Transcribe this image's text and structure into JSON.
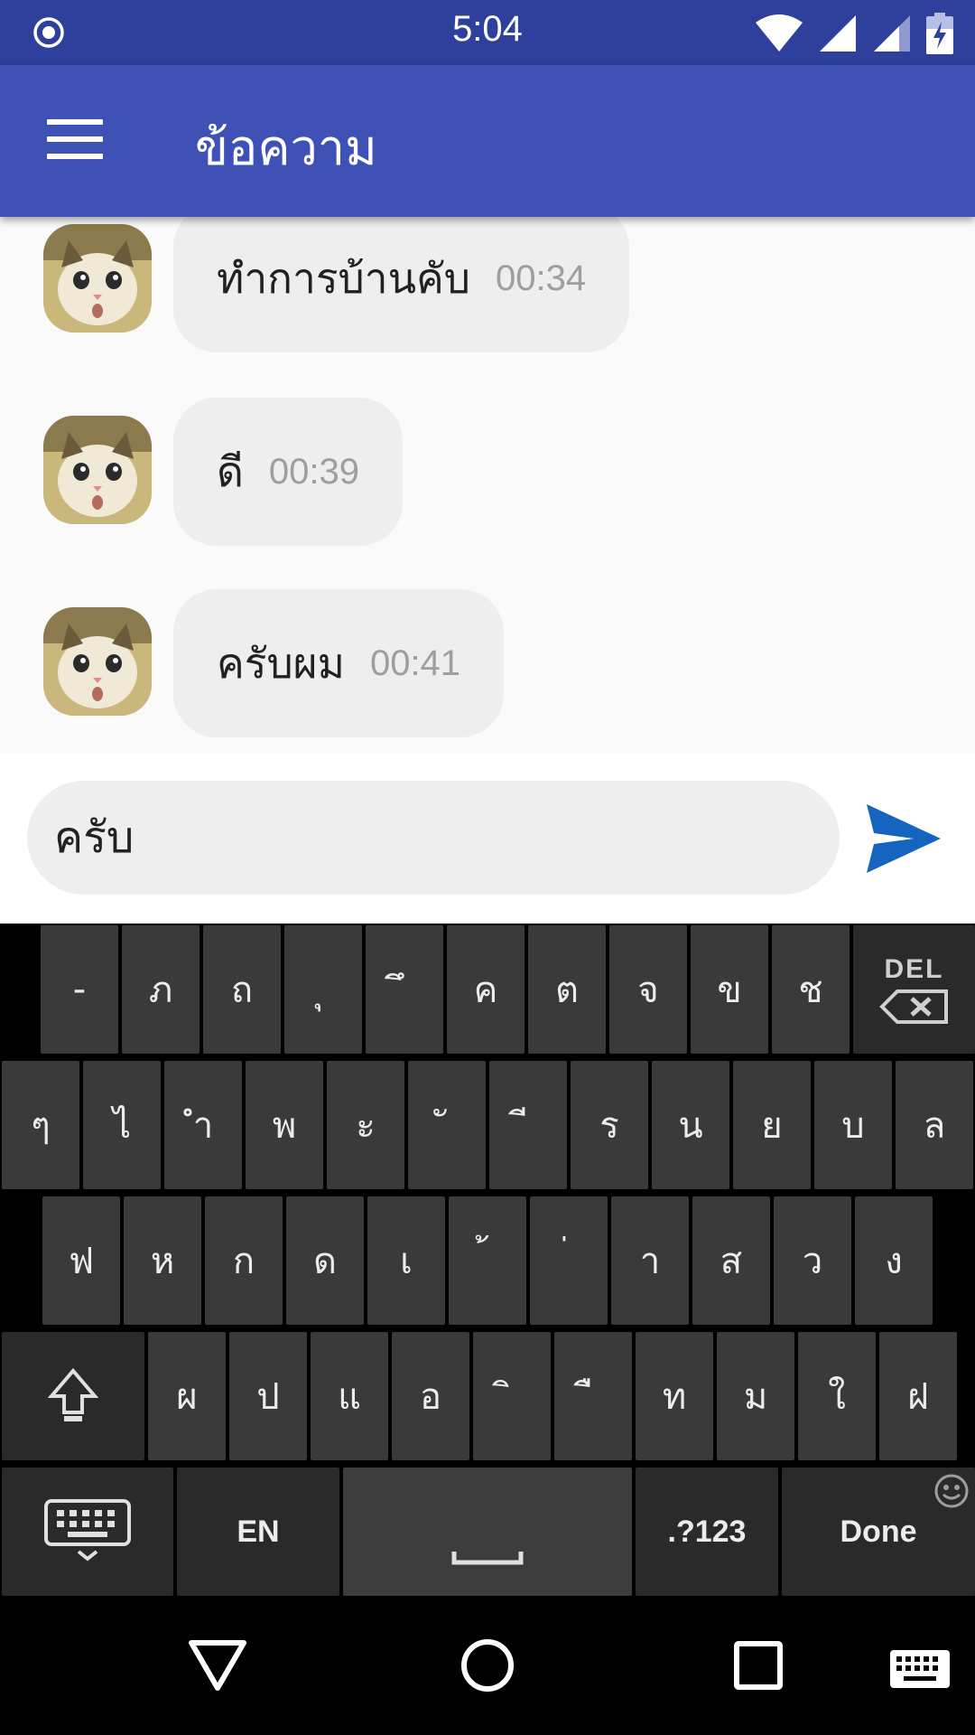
{
  "status_bar": {
    "time": "5:04",
    "left_icon": "record-icon",
    "right_icons": [
      "wifi-icon",
      "signal-icon",
      "signal-icon",
      "battery-charging-icon"
    ]
  },
  "app_bar": {
    "title": "ข้อความ",
    "menu_icon": "menu-icon"
  },
  "messages": [
    {
      "text": "ทำการบ้านคับ",
      "time": "00:34"
    },
    {
      "text": "ดี",
      "time": "00:39"
    },
    {
      "text": "ครับผม",
      "time": "00:41"
    }
  ],
  "composer": {
    "value": "ครับ",
    "send_icon": "send-icon"
  },
  "keyboard": {
    "row1": [
      "-",
      "ภ",
      "ถ",
      "ุ",
      "ึ",
      "ค",
      "ต",
      "จ",
      "ข",
      "ช"
    ],
    "del_label": "DEL",
    "row2": [
      "ๆ",
      "ไ",
      "ำ",
      "พ",
      "ะ",
      "ั",
      "ี",
      "ร",
      "น",
      "ย",
      "บ",
      "ล"
    ],
    "row3": [
      "ฟ",
      "ห",
      "ก",
      "ด",
      "เ",
      "้",
      "่",
      "า",
      "ส",
      "ว",
      "ง"
    ],
    "row4": [
      "ผ",
      "ป",
      "แ",
      "อ",
      "ิ",
      "ื",
      "ท",
      "ม",
      "ใ",
      "ฝ"
    ],
    "lang_label": "EN",
    "symbols_label": ".?123",
    "done_label": "Done"
  },
  "colors": {
    "status_bar": "#2e3f9c",
    "app_bar": "#3f51b5",
    "bubble": "#eeeeee",
    "send": "#1565c0"
  }
}
